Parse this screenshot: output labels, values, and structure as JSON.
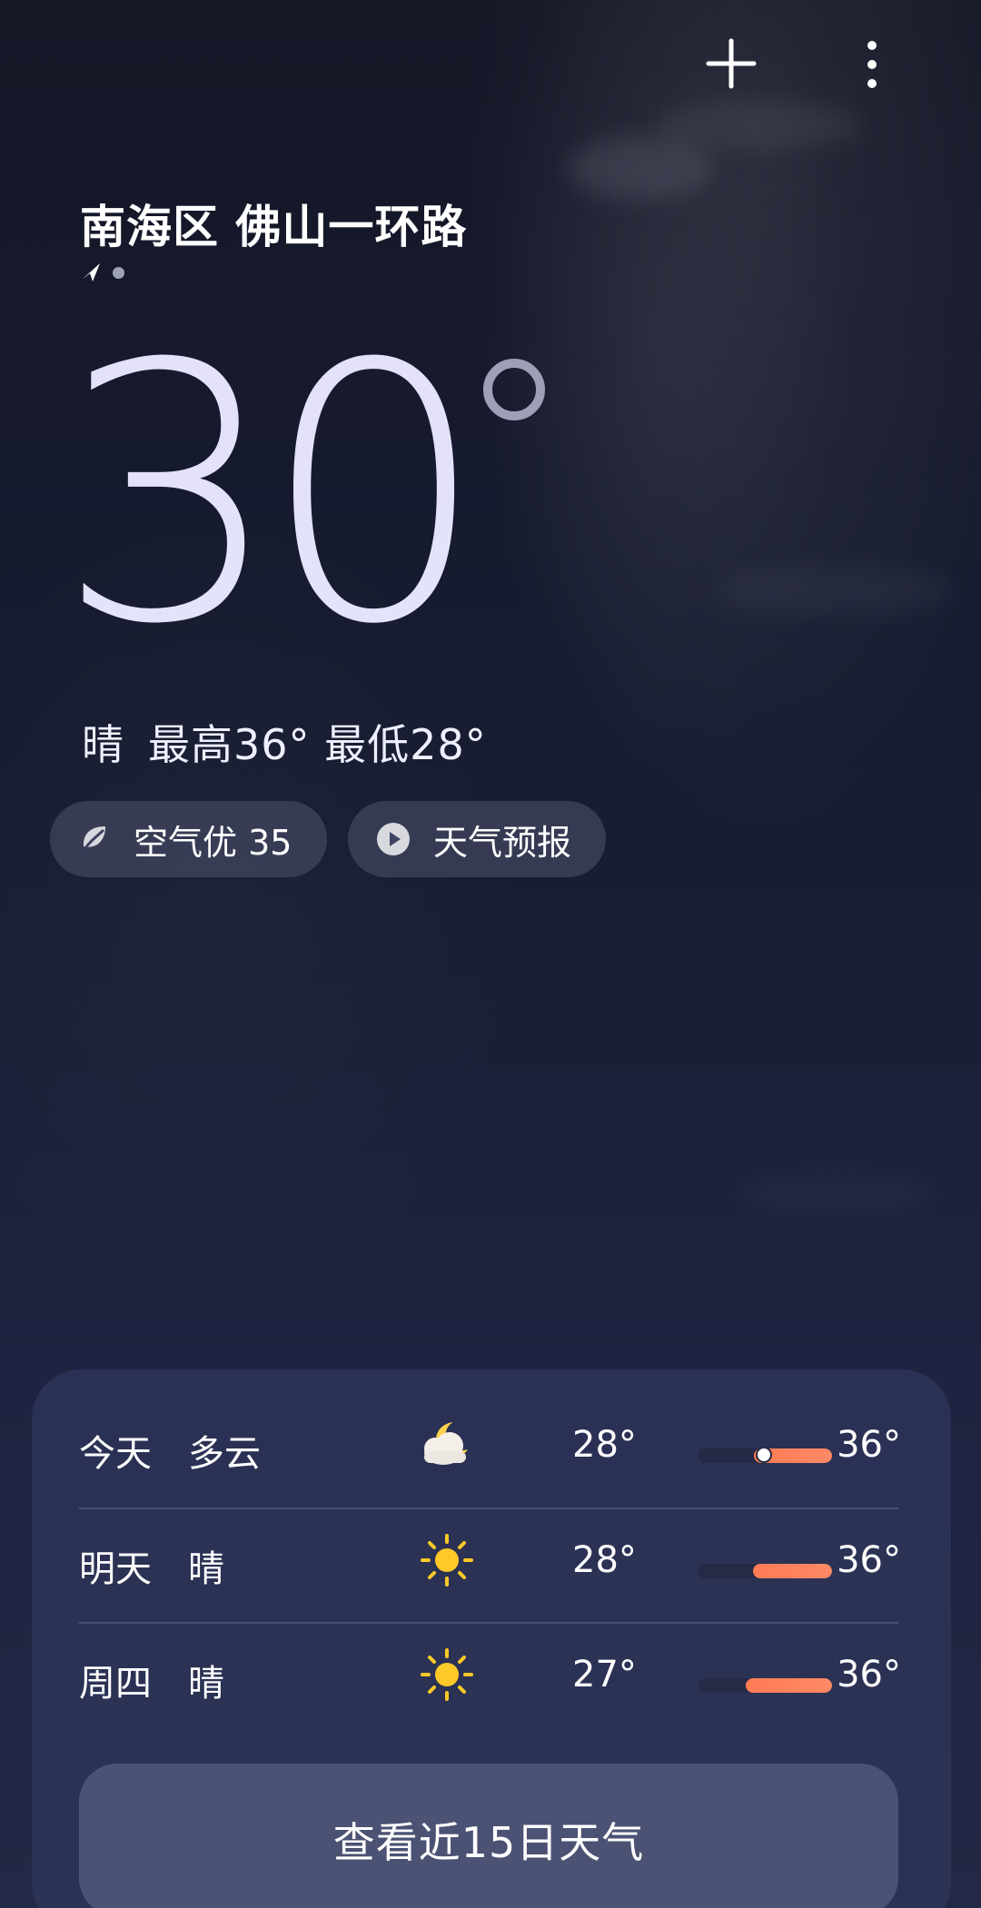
{
  "location": {
    "name": "南海区 佛山一环路",
    "icons": [
      "location-arrow-icon",
      "page-indicator-dot-icon"
    ]
  },
  "current": {
    "temperature": "30",
    "condition": "晴",
    "high": "最高36°",
    "low": "最低28°"
  },
  "pills": {
    "air_quality": "空气优 35",
    "forecast": "天气预报"
  },
  "daily": [
    {
      "day": "今天",
      "condition": "多云",
      "icon": "cloud-moon-icon",
      "low": "28°",
      "high": "36°",
      "range_start": 0.42,
      "range_end": 1.0,
      "current_marker": 0.49
    },
    {
      "day": "明天",
      "condition": "晴",
      "icon": "sun-icon",
      "low": "28°",
      "high": "36°",
      "range_start": 0.41,
      "range_end": 1.0,
      "current_marker": null
    },
    {
      "day": "周四",
      "condition": "晴",
      "icon": "sun-icon",
      "low": "27°",
      "high": "36°",
      "range_start": 0.36,
      "range_end": 1.0,
      "current_marker": null
    }
  ],
  "buttons": {
    "fifteen_day": "查看近15日天气"
  },
  "colors": {
    "background": "#181d33",
    "card": "#2d3356",
    "range": "#ff7b54",
    "sun": "#ffc928"
  }
}
